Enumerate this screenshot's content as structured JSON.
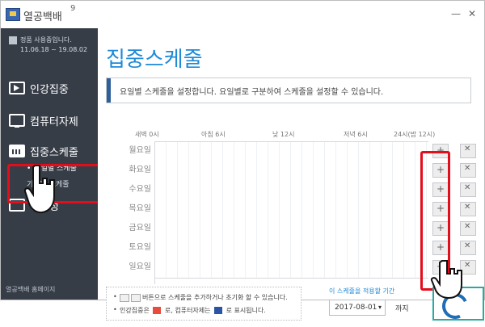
{
  "window": {
    "title": "열공백배",
    "version": "9"
  },
  "sidebar": {
    "license_text": "정품 사용중입니다.",
    "license_date": "11.06.18 ~ 19.08.02",
    "items": [
      {
        "label": "인강집중"
      },
      {
        "label": "컴퓨터자제"
      },
      {
        "label": "집중스케줄"
      },
      {
        "label": "경설정"
      }
    ],
    "sub_items": [
      {
        "label": "요일별 스케줄"
      },
      {
        "label": "기간별 스케줄"
      }
    ],
    "homepage_link": "열공백배 홈페이지"
  },
  "main": {
    "page_title": "집중스케줄",
    "description": "요일별 스케줄을 설정합니다. 요일별로 구분하여 스케줄을 설정할 수 있습니다.",
    "time_labels": [
      "새벽 0시",
      "아침 6시",
      "낮 12시",
      "저녁 6시",
      "24시(밤 12시)"
    ],
    "days": [
      "월요일",
      "화요일",
      "수요일",
      "목요일",
      "금요일",
      "토요일",
      "일요일"
    ],
    "legend": {
      "line1": "버튼으로 스케줄을 추가하거나 초기화 할 수 있습니다.",
      "line2_prefix": "인강집중은",
      "line2_mid": "로, 컴퓨터자제는",
      "line2_suffix": "로 표시됩니다."
    },
    "apply_period": {
      "label": "이 스케줄을 적용할 기간",
      "date": "2017-08-01",
      "until": "까지"
    }
  }
}
